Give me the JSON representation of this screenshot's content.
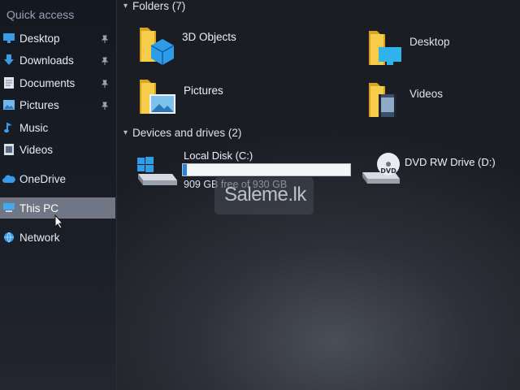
{
  "sidebar": {
    "header": "Quick access",
    "quick_access": [
      {
        "label": "Desktop",
        "icon": "desktop-icon",
        "pinned": true
      },
      {
        "label": "Downloads",
        "icon": "downloads-icon",
        "pinned": true
      },
      {
        "label": "Documents",
        "icon": "documents-icon",
        "pinned": true
      },
      {
        "label": "Pictures",
        "icon": "pictures-icon",
        "pinned": true
      },
      {
        "label": "Music",
        "icon": "music-icon",
        "pinned": false
      },
      {
        "label": "Videos",
        "icon": "videos-icon",
        "pinned": false
      }
    ],
    "onedrive": "OneDrive",
    "this_pc": "This PC",
    "network": "Network",
    "selected": "This PC"
  },
  "folders_group": {
    "title": "Folders (7)",
    "items": [
      {
        "label": "3D Objects",
        "icon": "3d-objects-folder-icon"
      },
      {
        "label": "Desktop",
        "icon": "desktop-folder-icon"
      },
      {
        "label": "Pictures",
        "icon": "pictures-folder-icon"
      },
      {
        "label": "Videos",
        "icon": "videos-folder-icon"
      }
    ]
  },
  "drives_group": {
    "title": "Devices and drives (2)",
    "local_disk": {
      "name": "Local Disk (C:)",
      "free_text": "909 GB free of 930 GB",
      "used_fraction": 0.0226,
      "icon": "windows-drive-icon"
    },
    "dvd_drive": {
      "name": "DVD RW Drive (D:)",
      "icon": "dvd-drive-icon",
      "badge": "DVD"
    }
  },
  "watermark": "Saleme.lk",
  "colors": {
    "folder_yellow": "#f4c542",
    "accent_blue": "#2a83d6",
    "selection": "#6f7784"
  }
}
